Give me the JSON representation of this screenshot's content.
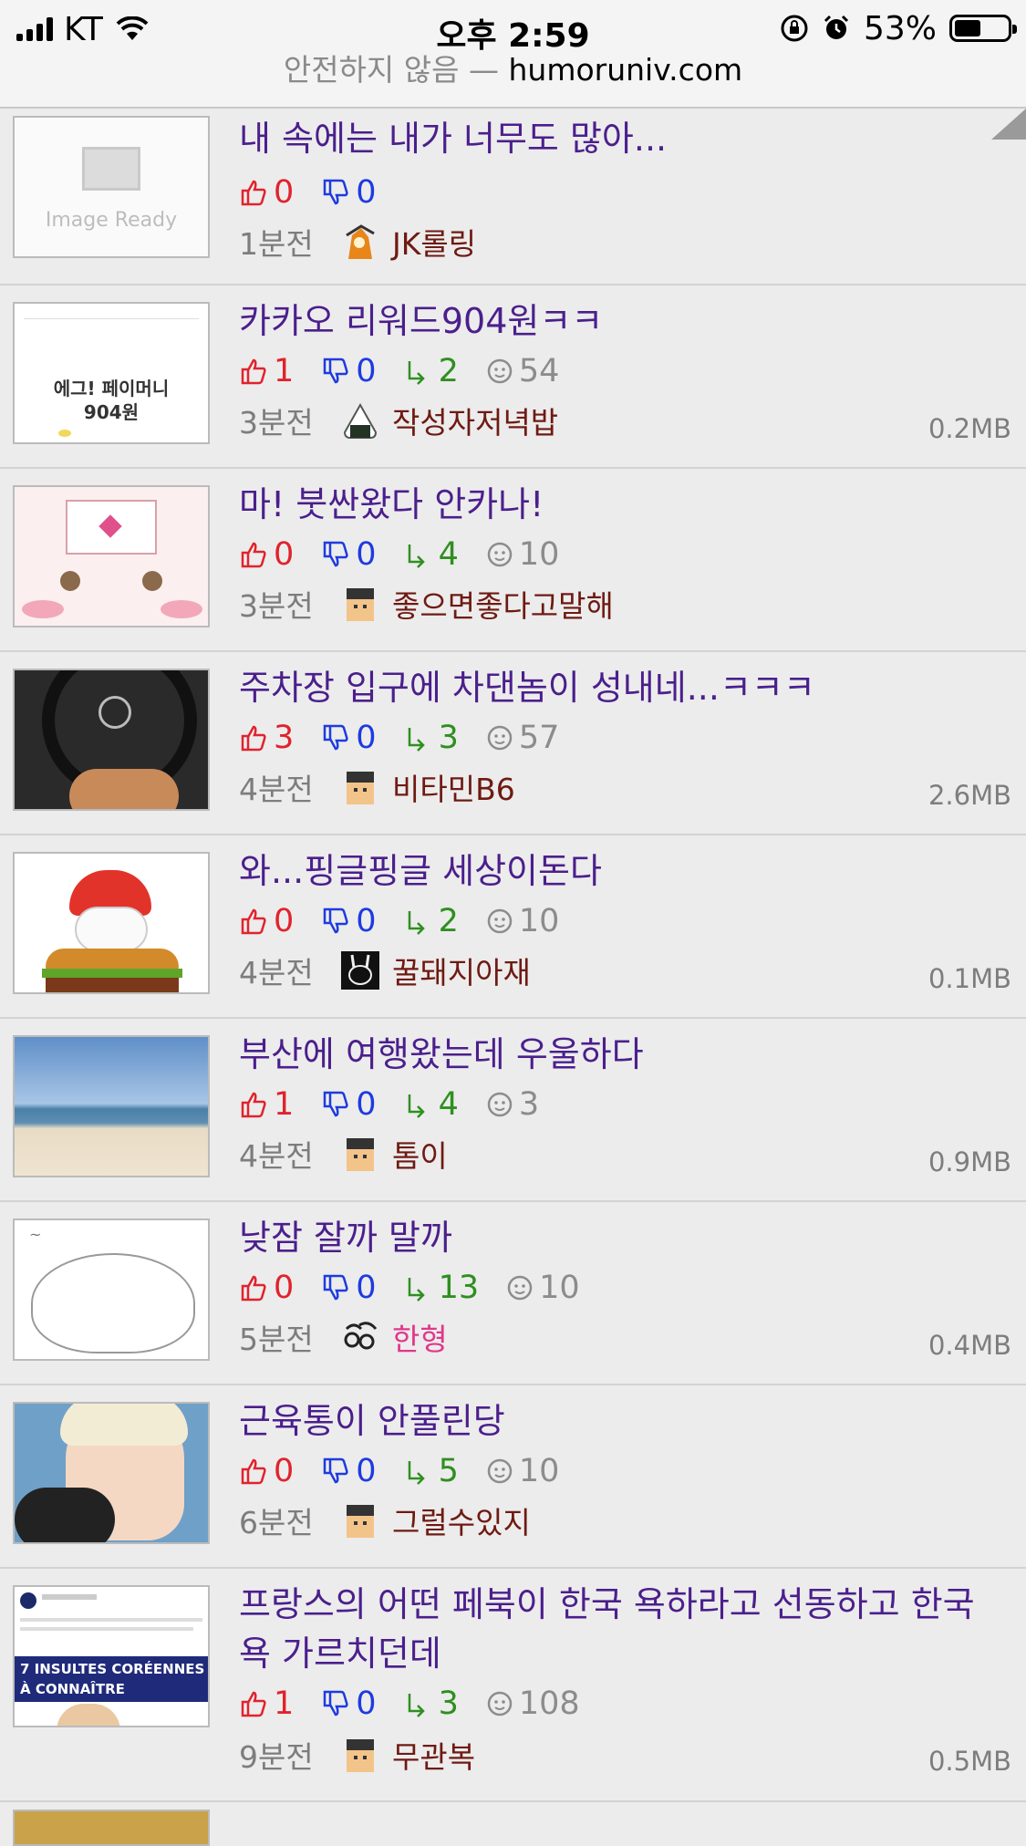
{
  "status": {
    "carrier": "KT",
    "time": "오후 2:59",
    "battery": "53%"
  },
  "url_bar": {
    "security": "안전하지 않음",
    "separator": " — ",
    "domain": "humoruniv.com"
  },
  "posts": [
    {
      "title": "내 속에는 내가 너무도 많아...",
      "up": "0",
      "down": "0",
      "time": "1분전",
      "author": "JK롤링",
      "thumb": "image-ready",
      "thumb_label": "Image Ready"
    },
    {
      "title": "카카오 리워드904원ㅋㅋ",
      "up": "1",
      "down": "0",
      "replies": "2",
      "views": "54",
      "time": "3분전",
      "author": "작성자저녁밥",
      "size": "0.2MB",
      "thumb_label": "에그! 페이머니 904원"
    },
    {
      "title": "마! 붓싼왔다 안카나!",
      "up": "0",
      "down": "0",
      "replies": "4",
      "views": "10",
      "time": "3분전",
      "author": "좋으면좋다고말해"
    },
    {
      "title": "주차장 입구에 차댄놈이 성내네...ㅋㅋㅋ",
      "up": "3",
      "down": "0",
      "replies": "3",
      "views": "57",
      "time": "4분전",
      "author": "비타민B6",
      "size": "2.6MB"
    },
    {
      "title": "와...핑글핑글 세상이돈다",
      "up": "0",
      "down": "0",
      "replies": "2",
      "views": "10",
      "time": "4분전",
      "author": "꿀돼지아재",
      "size": "0.1MB"
    },
    {
      "title": "부산에 여행왔는데 우울하다",
      "up": "1",
      "down": "0",
      "replies": "4",
      "views": "3",
      "time": "4분전",
      "author": "톰이",
      "size": "0.9MB"
    },
    {
      "title": "낮잠 잘까 말까",
      "up": "0",
      "down": "0",
      "replies": "13",
      "views": "10",
      "time": "5분전",
      "author": "한형",
      "size": "0.4MB"
    },
    {
      "title": "근육통이 안풀린당",
      "up": "0",
      "down": "0",
      "replies": "5",
      "views": "10",
      "time": "6분전",
      "author": "그럴수있지"
    },
    {
      "title": "프랑스의 어떤 페북이 한국 욕하라고 선동하고 한국 욕 가르치던데",
      "up": "1",
      "down": "0",
      "replies": "3",
      "views": "108",
      "time": "9분전",
      "author": "무관복",
      "size": "0.5MB",
      "thumb_label": "7 INSULTES CORÉENNES À CONNAÎTRE"
    }
  ],
  "colors": {
    "title": "#4b1f8c",
    "up": "#e0232d",
    "down": "#1e3be0",
    "reply": "#2f8f20",
    "author": "#6e1a12"
  }
}
